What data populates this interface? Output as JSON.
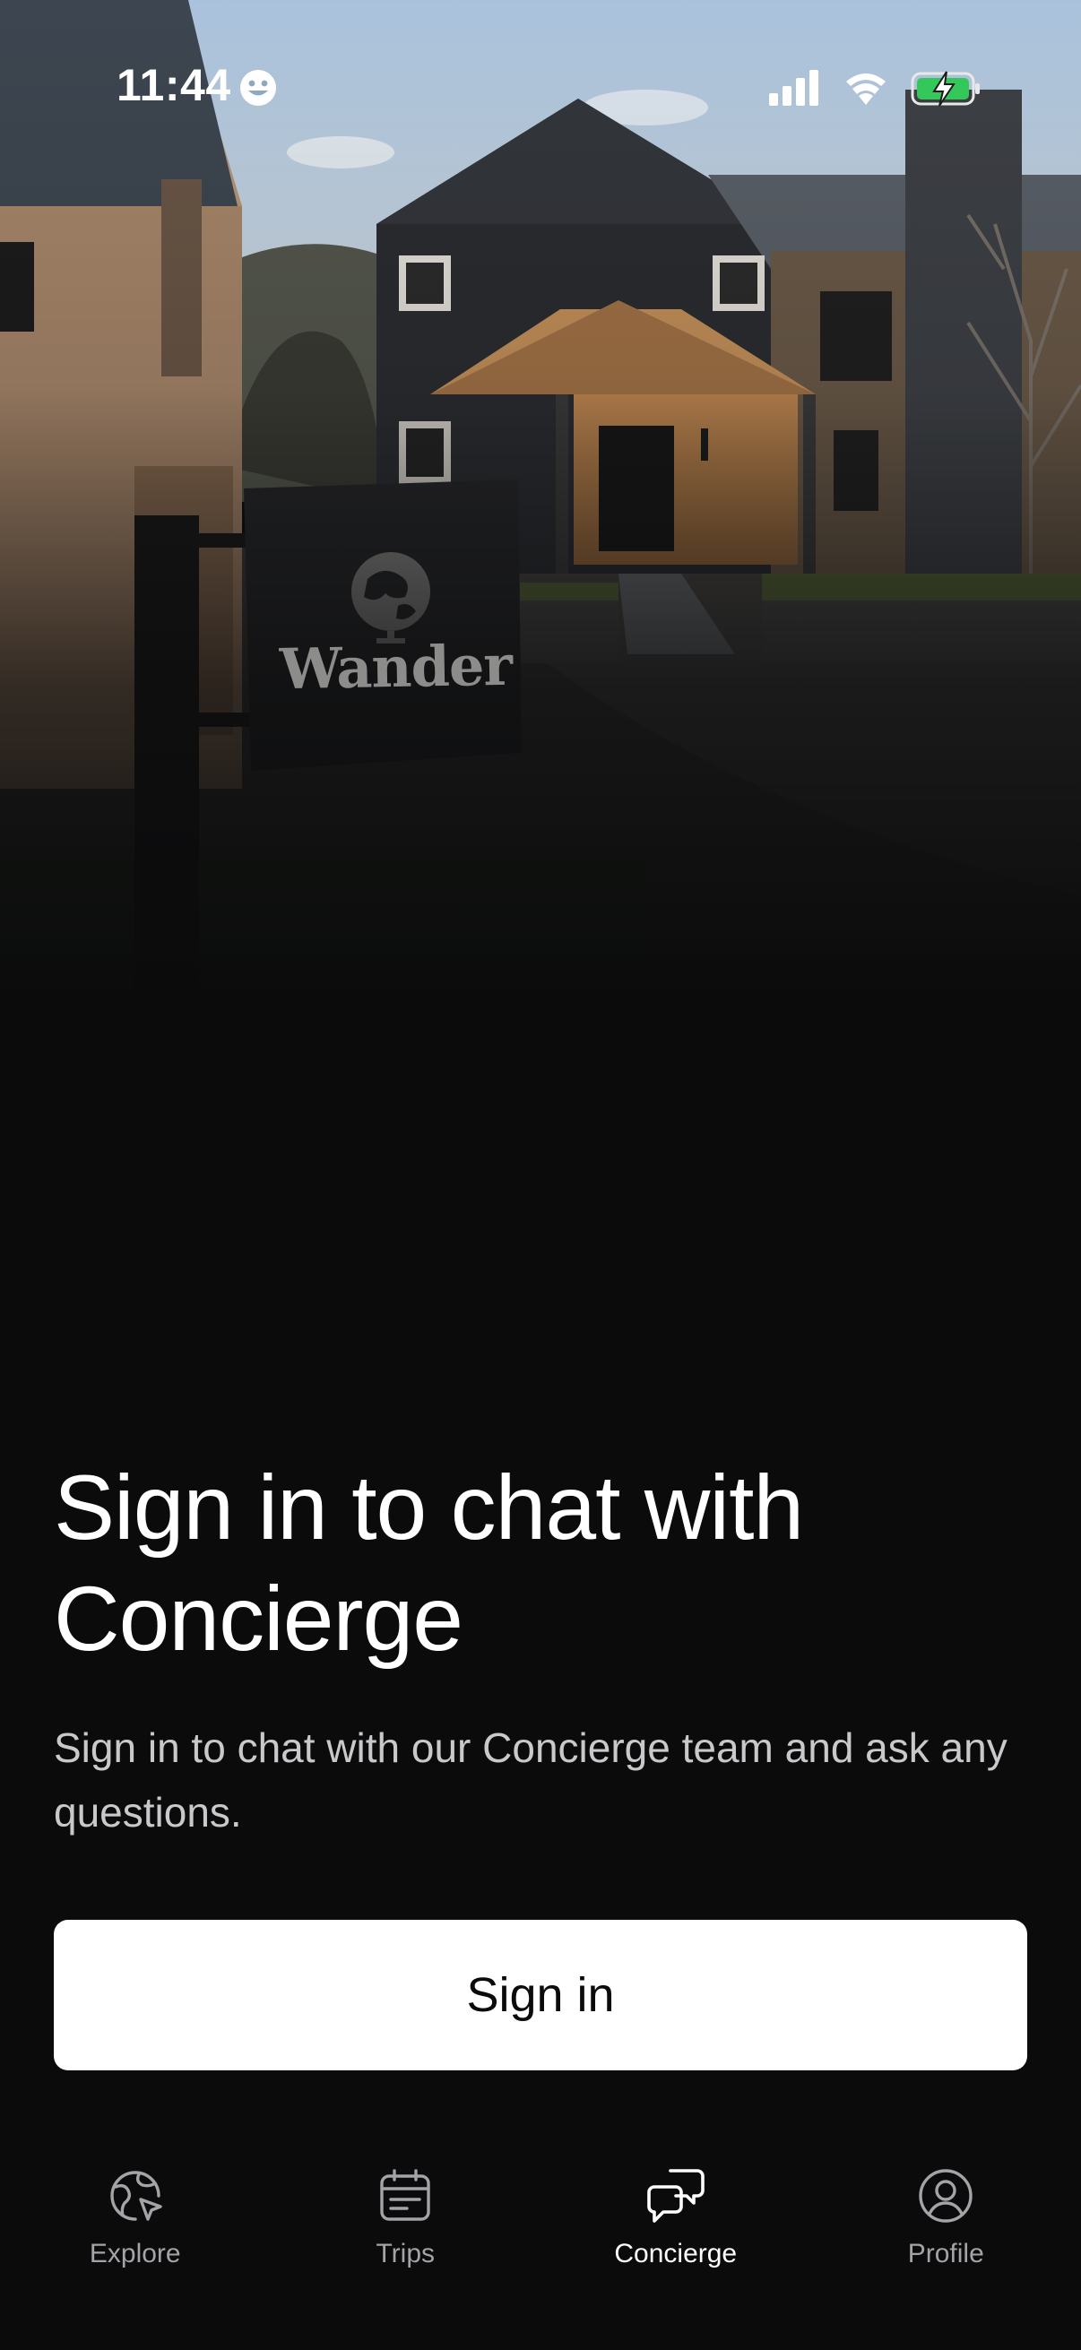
{
  "status_bar": {
    "time": "11:44",
    "battery_color": "#34c759"
  },
  "hero": {
    "sign_text": "Wander"
  },
  "content": {
    "headline": "Sign in to chat with Concierge",
    "subtext": "Sign in to chat with our Concierge team and ask any questions.",
    "signin_label": "Sign in"
  },
  "tab_bar": {
    "tabs": [
      {
        "label": "Explore",
        "icon": "globe-cursor-icon",
        "active": false
      },
      {
        "label": "Trips",
        "icon": "calendar-icon",
        "active": false
      },
      {
        "label": "Concierge",
        "icon": "chat-bubbles-icon",
        "active": true
      },
      {
        "label": "Profile",
        "icon": "user-circle-icon",
        "active": false
      }
    ]
  },
  "colors": {
    "background": "#0b0b0c",
    "button_bg": "#ffffff",
    "inactive_tab": "#a3a3a8",
    "active_tab": "#ffffff"
  }
}
